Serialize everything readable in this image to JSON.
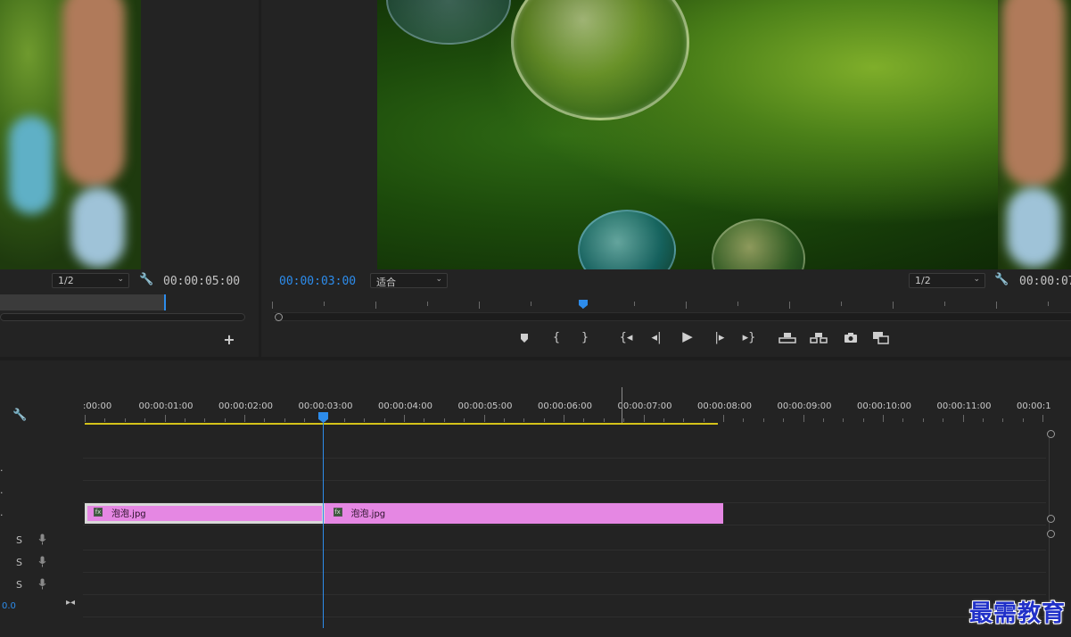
{
  "source_monitor": {
    "zoom_select": "1/2",
    "duration_timecode": "00:00:05:00"
  },
  "program_monitor": {
    "current_timecode": "00:00:03:00",
    "fit_select": "适合",
    "zoom_select": "1/2",
    "duration_timecode": "00:00:07:"
  },
  "transport": {
    "icons": [
      "marker-icon",
      "mark-in-icon",
      "mark-out-icon",
      "go-to-in-icon",
      "step-back-icon",
      "play-icon",
      "step-forward-icon",
      "go-to-out-icon",
      "lift-icon",
      "extract-icon",
      "export-frame-icon",
      "compare-icon"
    ]
  },
  "timeline": {
    "ruler_labels": [
      ":00:00",
      "00:00:01:00",
      "00:00:02:00",
      "00:00:03:00",
      "00:00:04:00",
      "00:00:05:00",
      "00:00:06:00",
      "00:00:07:00",
      "00:00:08:00",
      "00:00:09:00",
      "00:00:10:00",
      "00:00:11:00",
      "00:00:1"
    ],
    "playhead_time": "00:00:03:00",
    "clips": [
      {
        "name": "泡泡.jpg",
        "start_s": 0,
        "end_s": 3.0,
        "selected": true
      },
      {
        "name": "泡泡.jpg",
        "start_s": 3.0,
        "end_s": 8.0,
        "selected": false
      }
    ],
    "audio_tracks": [
      {
        "solo_label": "S"
      },
      {
        "solo_label": "S"
      },
      {
        "solo_label": "S"
      }
    ],
    "master_value": "0.0"
  },
  "watermark": "最需教育",
  "colors": {
    "accent_blue": "#2d8ceb",
    "clip_pink": "#e587e3",
    "work_area_yellow": "#d4c21a"
  }
}
